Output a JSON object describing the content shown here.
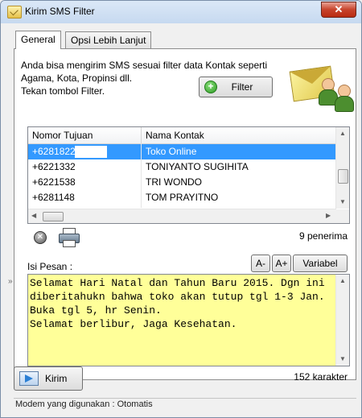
{
  "window": {
    "title": "Kirim SMS Filter",
    "close_label": "✕"
  },
  "tabs": [
    {
      "label": "General",
      "active": true
    },
    {
      "label": "Opsi Lebih Lanjut",
      "active": false
    }
  ],
  "intro_text": "Anda bisa mengirim SMS sesuai filter data Kontak seperti\nAgama, Kota, Propinsi dll.\nTekan tombol Filter.",
  "filter_button": {
    "label": "Filter",
    "icon": "plus-icon"
  },
  "table": {
    "columns": [
      "Nomor Tujuan",
      "Nama Kontak"
    ],
    "rows": [
      {
        "number": "+6281822",
        "name": "Toko Online",
        "selected": true
      },
      {
        "number": "+6221332",
        "name": "TONIYANTO SUGIHITA",
        "selected": false
      },
      {
        "number": "+6221538",
        "name": "TRI WONDO",
        "selected": false
      },
      {
        "number": "+6281148",
        "name": "TOM PRAYITNO",
        "selected": false
      }
    ]
  },
  "recipient_count": "9 penerima",
  "message": {
    "label": "Isi Pesan :",
    "buttons": [
      "A-",
      "A+",
      "Variabel"
    ],
    "text": "Selamat Hari Natal dan Tahun Baru 2015. Dgn ini\ndiberitahukn bahwa toko akan tutup tgl 1-3 Jan.\nBuka tgl 5, hr Senin.\nSelamat berlibur, Jaga Kesehatan.",
    "char_count": "152 karakter"
  },
  "send_button": {
    "label": "Kirim"
  },
  "status": "Modem yang digunakan : Otomatis",
  "colors": {
    "selected_row": "#3399ff",
    "message_bg": "#ffff99"
  }
}
